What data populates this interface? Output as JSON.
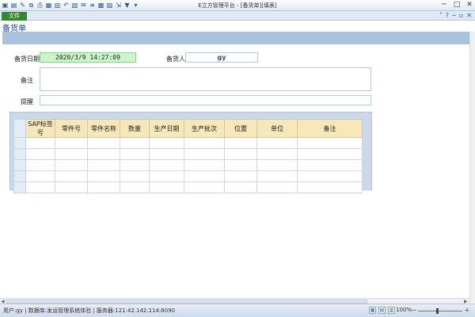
{
  "window": {
    "title": "E立方管理平台 - [备货单][填表]",
    "qa_icons": [
      "save-icon",
      "save-as-icon",
      "edit-icon",
      "copy-icon",
      "print-icon",
      "print-preview-icon",
      "chart-icon",
      "undo-icon",
      "calendar-icon",
      "email-icon",
      "align-icon",
      "table-icon",
      "grid-icon",
      "export-icon",
      "filter-icon",
      "dropdown-icon"
    ],
    "qa_glyphs": [
      "▣",
      "▤",
      "✎",
      "⧉",
      "⎙",
      "▦",
      "▥",
      "↶",
      "▧",
      "✉",
      "≡",
      "▩",
      "▨",
      "⇲",
      "▼",
      "▾"
    ],
    "controls": {
      "minimize": "─",
      "maximize": "□",
      "close": "✕"
    }
  },
  "menu": {
    "file_label": "文件",
    "help_glyphs": {
      "collapse": "˄",
      "help": "?",
      "min": "─",
      "restore": "▫",
      "close": "✕"
    }
  },
  "page": {
    "title": "备货单"
  },
  "form": {
    "date_label": "备货日期",
    "date_value": "2020/3/9 14:27:09",
    "person_label": "备货人",
    "person_value": "gy",
    "remark_label": "备注",
    "remark_value": "",
    "remind_label": "提醒",
    "remind_value": ""
  },
  "grid": {
    "columns": [
      "SAP标签号",
      "零件号",
      "零件名称",
      "数量",
      "生产日期",
      "生产批次",
      "位置",
      "单位",
      "备注"
    ],
    "row_count": 5
  },
  "status": {
    "text": "用户:gy | 数据库:发运管理系统体验 | 服务器:121.42.142.114:8090",
    "zoom": "100%",
    "zoom_minus": "－",
    "zoom_plus": "＋"
  }
}
